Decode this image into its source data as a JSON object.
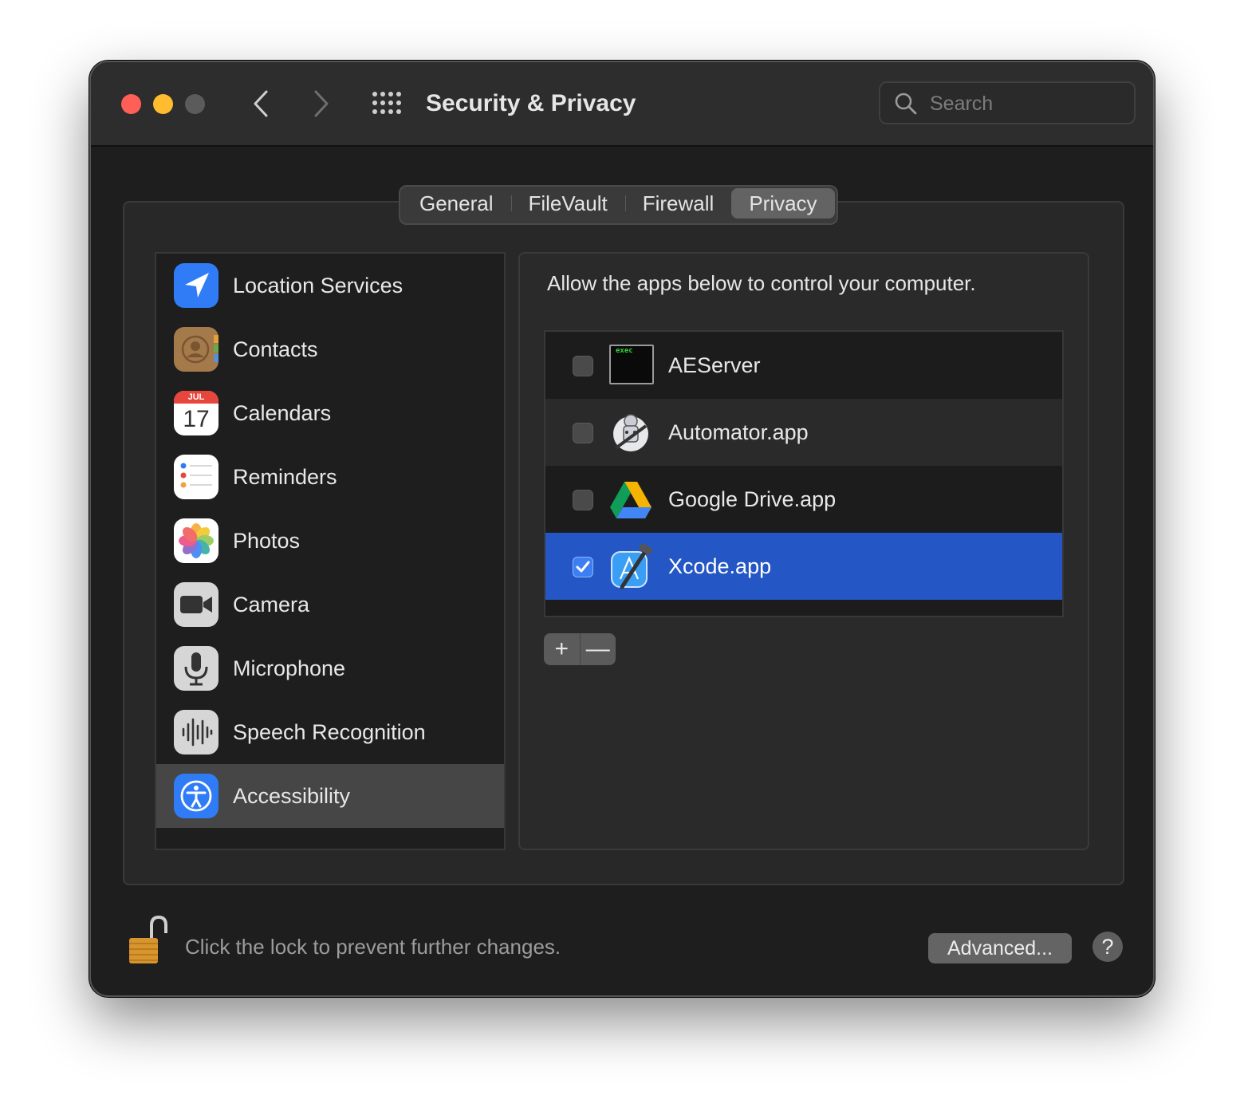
{
  "window": {
    "title": "Security & Privacy",
    "search": {
      "placeholder": "Search",
      "value": ""
    }
  },
  "tabs": [
    {
      "label": "General",
      "active": false
    },
    {
      "label": "FileVault",
      "active": false
    },
    {
      "label": "Firewall",
      "active": false
    },
    {
      "label": "Privacy",
      "active": true
    }
  ],
  "sidebar": {
    "selected_index": 8,
    "items": [
      {
        "label": "Location Services",
        "icon": "location-arrow-icon"
      },
      {
        "label": "Contacts",
        "icon": "contacts-icon"
      },
      {
        "label": "Calendars",
        "icon": "calendar-icon",
        "icon_month": "JUL",
        "icon_day": "17"
      },
      {
        "label": "Reminders",
        "icon": "reminders-icon"
      },
      {
        "label": "Photos",
        "icon": "photos-icon"
      },
      {
        "label": "Camera",
        "icon": "camera-icon"
      },
      {
        "label": "Microphone",
        "icon": "microphone-icon"
      },
      {
        "label": "Speech Recognition",
        "icon": "waveform-icon"
      },
      {
        "label": "Accessibility",
        "icon": "accessibility-icon"
      }
    ]
  },
  "content": {
    "description": "Allow the apps below to control your computer.",
    "apps": [
      {
        "label": "AEServer",
        "checked": false,
        "icon": "exec-terminal-icon",
        "icon_text": "exec"
      },
      {
        "label": "Automator.app",
        "checked": false,
        "icon": "automator-robot-icon"
      },
      {
        "label": "Google Drive.app",
        "checked": false,
        "icon": "google-drive-icon"
      },
      {
        "label": "Xcode.app",
        "checked": true,
        "selected": true,
        "icon": "xcode-hammer-icon"
      }
    ],
    "add_label": "+",
    "remove_label": "—"
  },
  "footer": {
    "lock_text": "Click the lock to prevent further changes.",
    "advanced_label": "Advanced...",
    "help_label": "?"
  },
  "colors": {
    "selection_blue": "#2457c5",
    "traffic_red": "#ff5f57",
    "traffic_yellow": "#febc2e"
  }
}
